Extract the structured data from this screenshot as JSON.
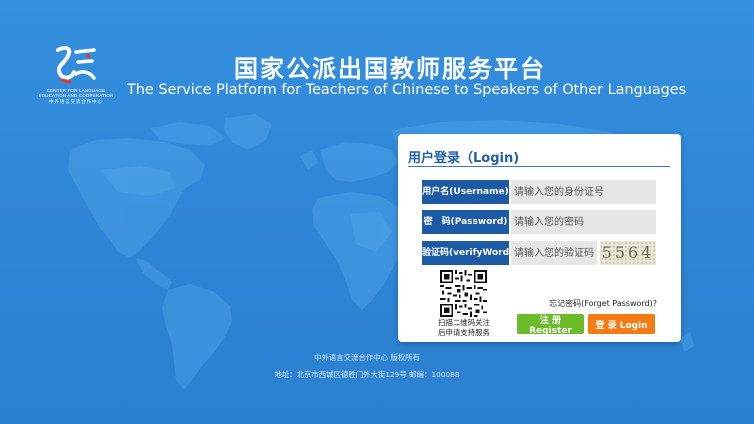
{
  "header": {
    "logo_text_line1": "CENTER FOR LANGUAGE",
    "logo_text_line2": "EDUCATION AND COOPERATION",
    "logo_text_line3": "中外语言交流合作中心",
    "title_cn": "国家公派出国教师服务平台",
    "title_en": "The Service Platform for Teachers of Chinese to Speakers of Other Languages"
  },
  "login": {
    "title": "用户登录（Login)",
    "username_label": "用户名(Username)",
    "username_placeholder": "请输入您的身份证号",
    "password_label": "密　码(Password)",
    "password_placeholder": "请输入您的密码",
    "code_label": "验证码(verifyWord)",
    "code_placeholder": "请输入您的验证码",
    "captcha_text": "5564",
    "qr_caption_line1": "扫描二维码关注",
    "qr_caption_line2": "后申请支持服务",
    "forgot_password": "忘记密码(Forget Password)?",
    "register_label": "注 册 Register",
    "login_label": "登 录 Login"
  },
  "footer": {
    "copyright": "中外语言交流合作中心 版权所有",
    "address": "地址：北京市西城区德胜门外大街129号 邮编：100088"
  },
  "icons": {
    "logo": "center-for-language-education-logo",
    "qr": "qr-code-icon"
  },
  "colors": {
    "background": "#2e86d6",
    "label_blue": "#1d5aa6",
    "register_green": "#6cbb2a",
    "login_orange": "#f47b14",
    "title_blue": "#1f5fa8"
  }
}
